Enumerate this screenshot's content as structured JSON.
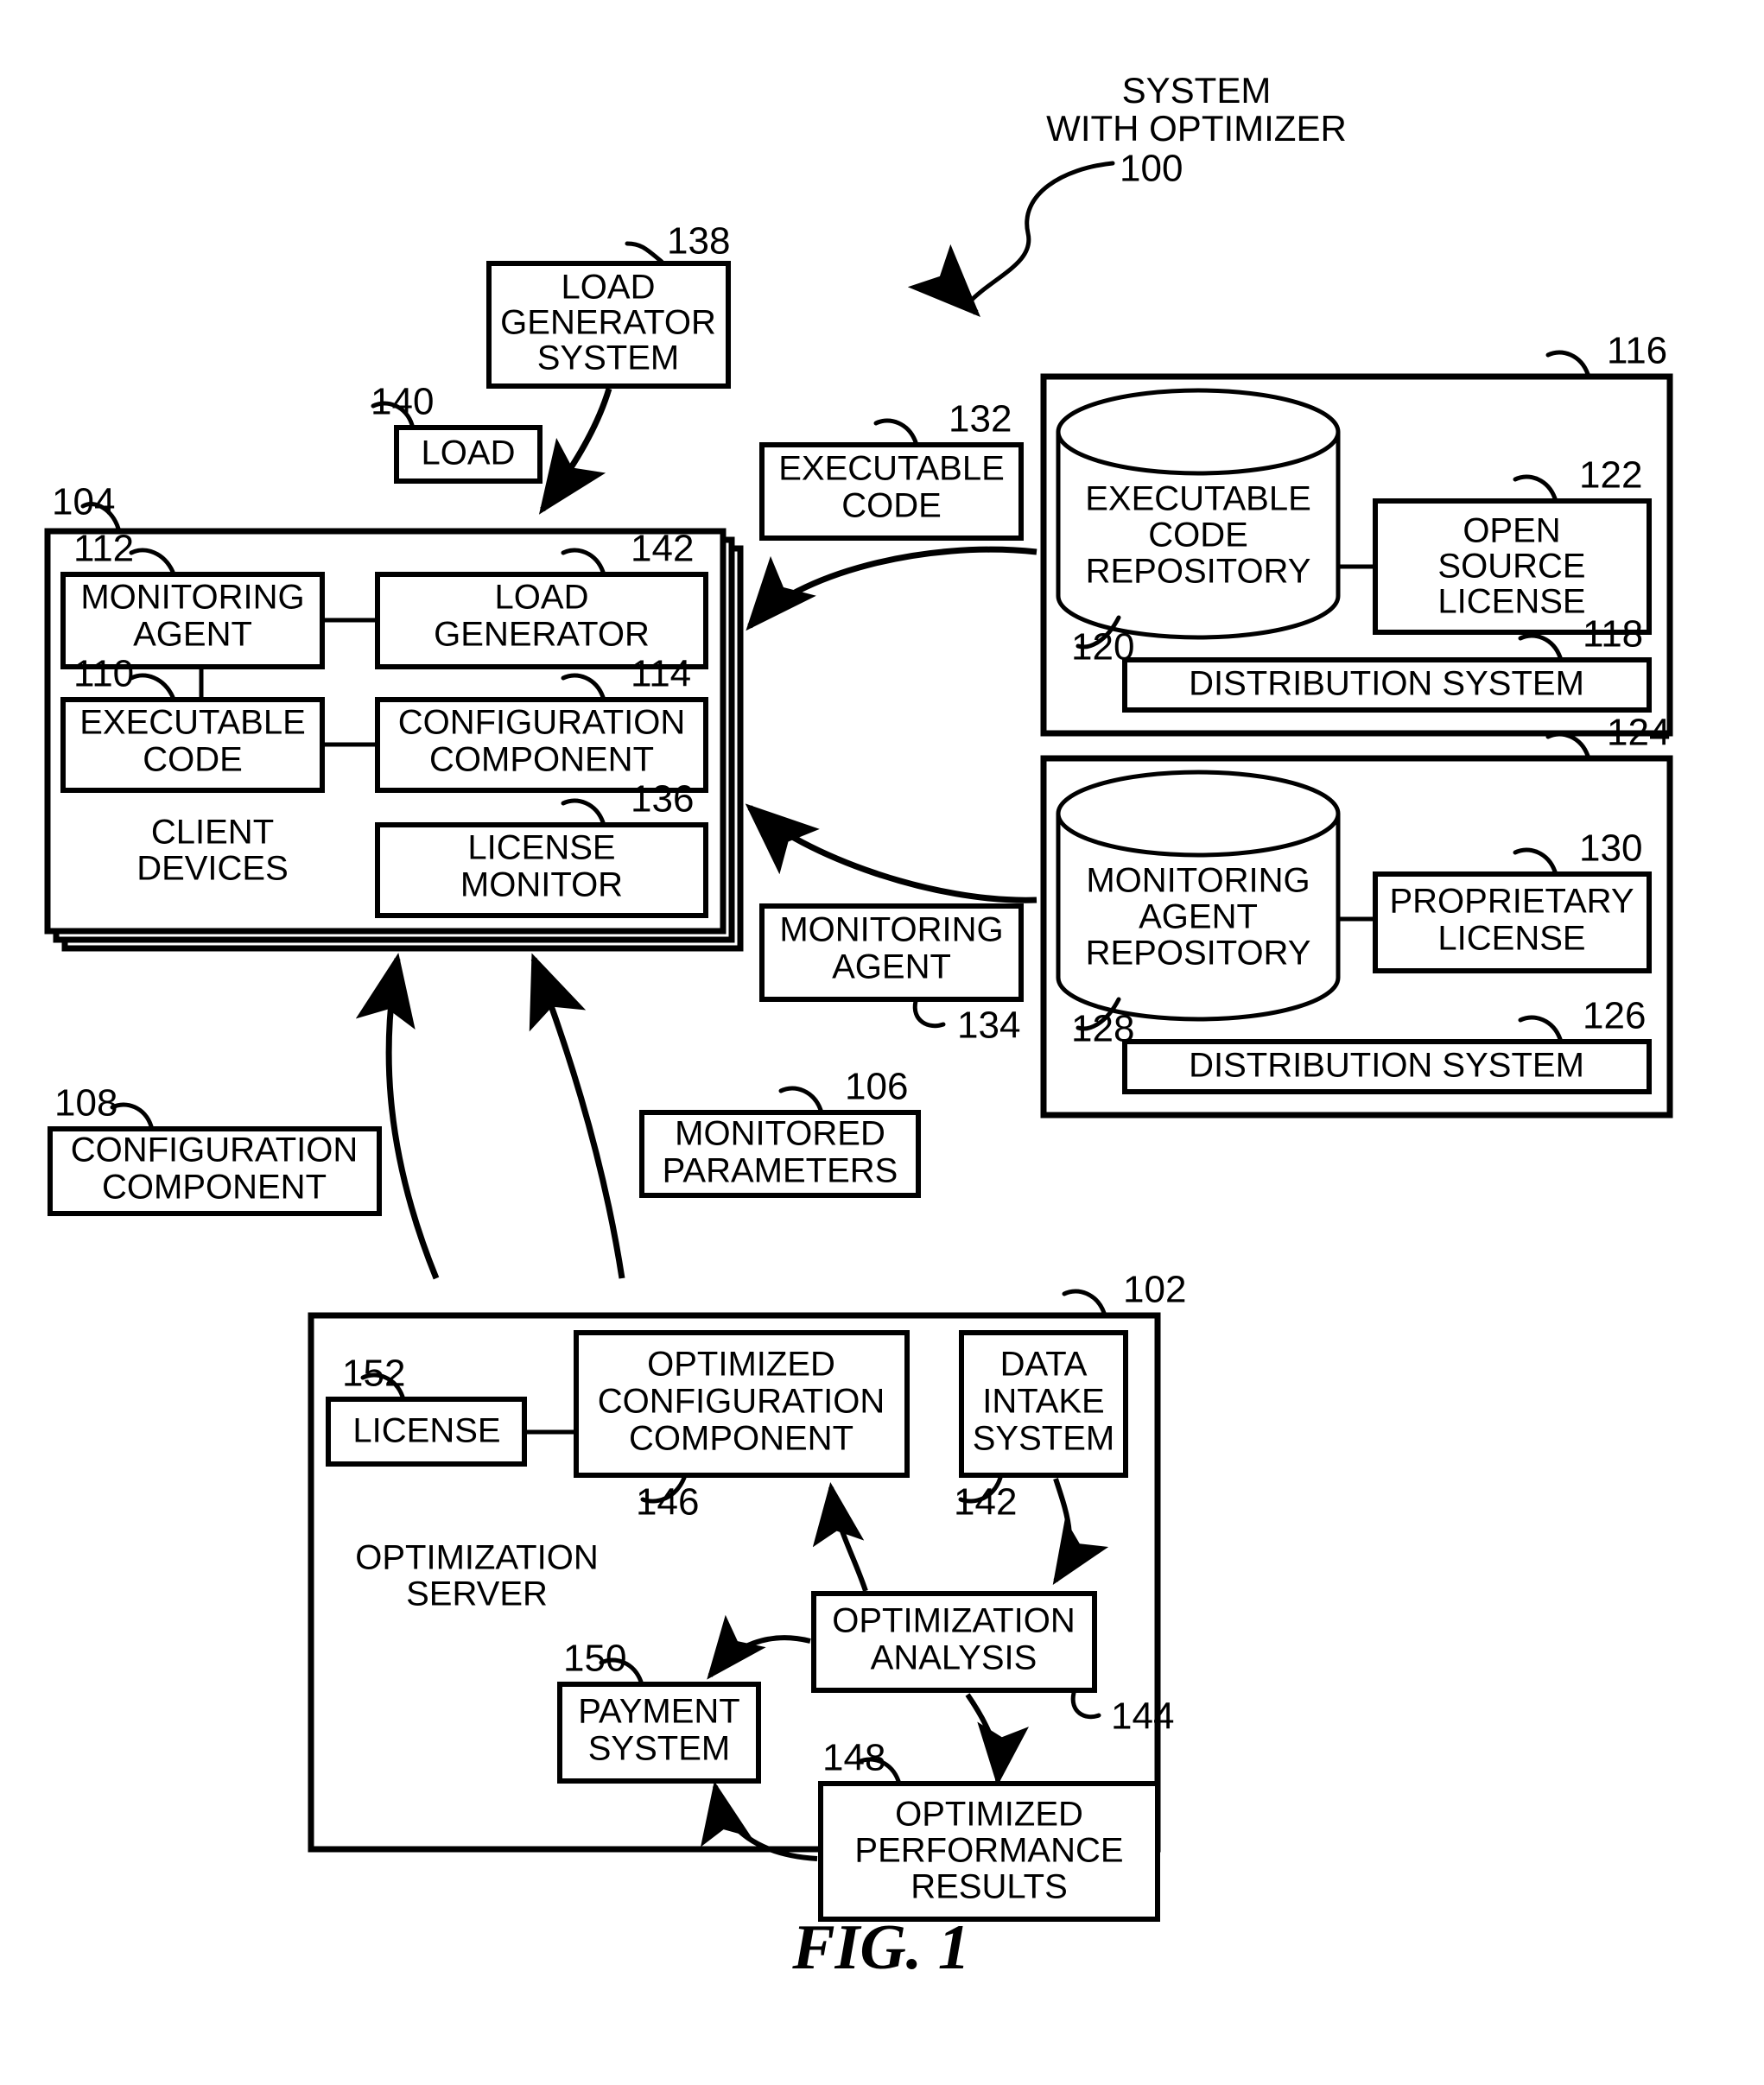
{
  "figure": {
    "caption": "FIG. 1",
    "title_line1": "SYSTEM",
    "title_line2": "WITH OPTIMIZER",
    "title_ref": "100"
  },
  "nodes": {
    "load_generator_system": {
      "line1": "LOAD",
      "line2": "GENERATOR",
      "line3": "SYSTEM",
      "ref": "138"
    },
    "load": {
      "line1": "LOAD",
      "ref": "140"
    },
    "client_devices": {
      "label_line1": "CLIENT",
      "label_line2": "DEVICES",
      "ref": "104"
    },
    "monitoring_agent_client": {
      "line1": "MONITORING",
      "line2": "AGENT",
      "ref": "112"
    },
    "load_generator": {
      "line1": "LOAD",
      "line2": "GENERATOR",
      "ref": "142"
    },
    "executable_code_client": {
      "line1": "EXECUTABLE",
      "line2": "CODE",
      "ref": "110"
    },
    "configuration_component_client": {
      "line1": "CONFIGURATION",
      "line2": "COMPONENT",
      "ref": "114"
    },
    "license_monitor": {
      "line1": "LICENSE",
      "line2": "MONITOR",
      "ref": "136"
    },
    "executable_code_transfer": {
      "line1": "EXECUTABLE",
      "line2": "CODE",
      "ref": "132"
    },
    "monitoring_agent_transfer": {
      "line1": "MONITORING",
      "line2": "AGENT",
      "ref": "134"
    },
    "code_repo_container": {
      "ref": "116"
    },
    "executable_code_repository": {
      "line1": "EXECUTABLE",
      "line2": "CODE",
      "line3": "REPOSITORY",
      "ref": "120"
    },
    "open_source_license": {
      "line1": "OPEN",
      "line2": "SOURCE",
      "line3": "LICENSE",
      "ref": "122"
    },
    "distribution_system_code": {
      "line1": "DISTRIBUTION SYSTEM",
      "ref": "118"
    },
    "agent_repo_container": {
      "ref": "124"
    },
    "monitoring_agent_repository": {
      "line1": "MONITORING",
      "line2": "AGENT",
      "line3": "REPOSITORY",
      "ref": "128"
    },
    "proprietary_license": {
      "line1": "PROPRIETARY",
      "line2": "LICENSE",
      "ref": "130"
    },
    "distribution_system_agent": {
      "line1": "DISTRIBUTION SYSTEM",
      "ref": "126"
    },
    "configuration_component_transfer": {
      "line1": "CONFIGURATION",
      "line2": "COMPONENT",
      "ref": "108"
    },
    "monitored_parameters": {
      "line1": "MONITORED",
      "line2": "PARAMETERS",
      "ref": "106"
    },
    "optimization_server": {
      "label_line1": "OPTIMIZATION",
      "label_line2": "SERVER",
      "ref": "102"
    },
    "license_server": {
      "line1": "LICENSE",
      "ref": "152"
    },
    "optimized_configuration_component": {
      "line1": "OPTIMIZED",
      "line2": "CONFIGURATION",
      "line3": "COMPONENT",
      "ref": "146"
    },
    "data_intake_system": {
      "line1": "DATA",
      "line2": "INTAKE",
      "line3": "SYSTEM",
      "ref": "142"
    },
    "optimization_analysis": {
      "line1": "OPTIMIZATION",
      "line2": "ANALYSIS",
      "ref": "144"
    },
    "payment_system": {
      "line1": "PAYMENT",
      "line2": "SYSTEM",
      "ref": "150"
    },
    "optimized_performance_results": {
      "line1": "OPTIMIZED",
      "line2": "PERFORMANCE",
      "line3": "RESULTS",
      "ref": "148"
    }
  },
  "colors": {
    "ink": "#000000",
    "paper": "#ffffff"
  }
}
